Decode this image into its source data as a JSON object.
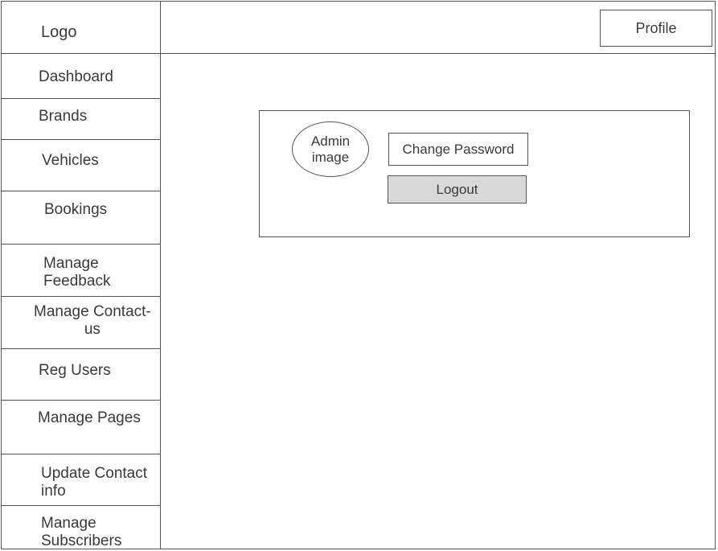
{
  "header": {
    "logo": "Logo",
    "profile_label": "Profile"
  },
  "sidebar": {
    "items": [
      {
        "label": "Dashboard"
      },
      {
        "label": "Brands"
      },
      {
        "label": "Vehicles"
      },
      {
        "label": "Bookings"
      },
      {
        "label": "Manage\nFeedback"
      },
      {
        "label": "Manage Contact-\nus"
      },
      {
        "label": "Reg Users"
      },
      {
        "label": "Manage Pages"
      },
      {
        "label": "Update Contact\ninfo"
      },
      {
        "label": "Manage\nSubscribers"
      }
    ]
  },
  "profile_card": {
    "avatar_label": "Admin\nimage",
    "change_password_label": "Change Password",
    "logout_label": "Logout"
  },
  "colors": {
    "border": "#555555",
    "logout_bg": "#d9d9d9",
    "text": "#3a3a3a"
  }
}
